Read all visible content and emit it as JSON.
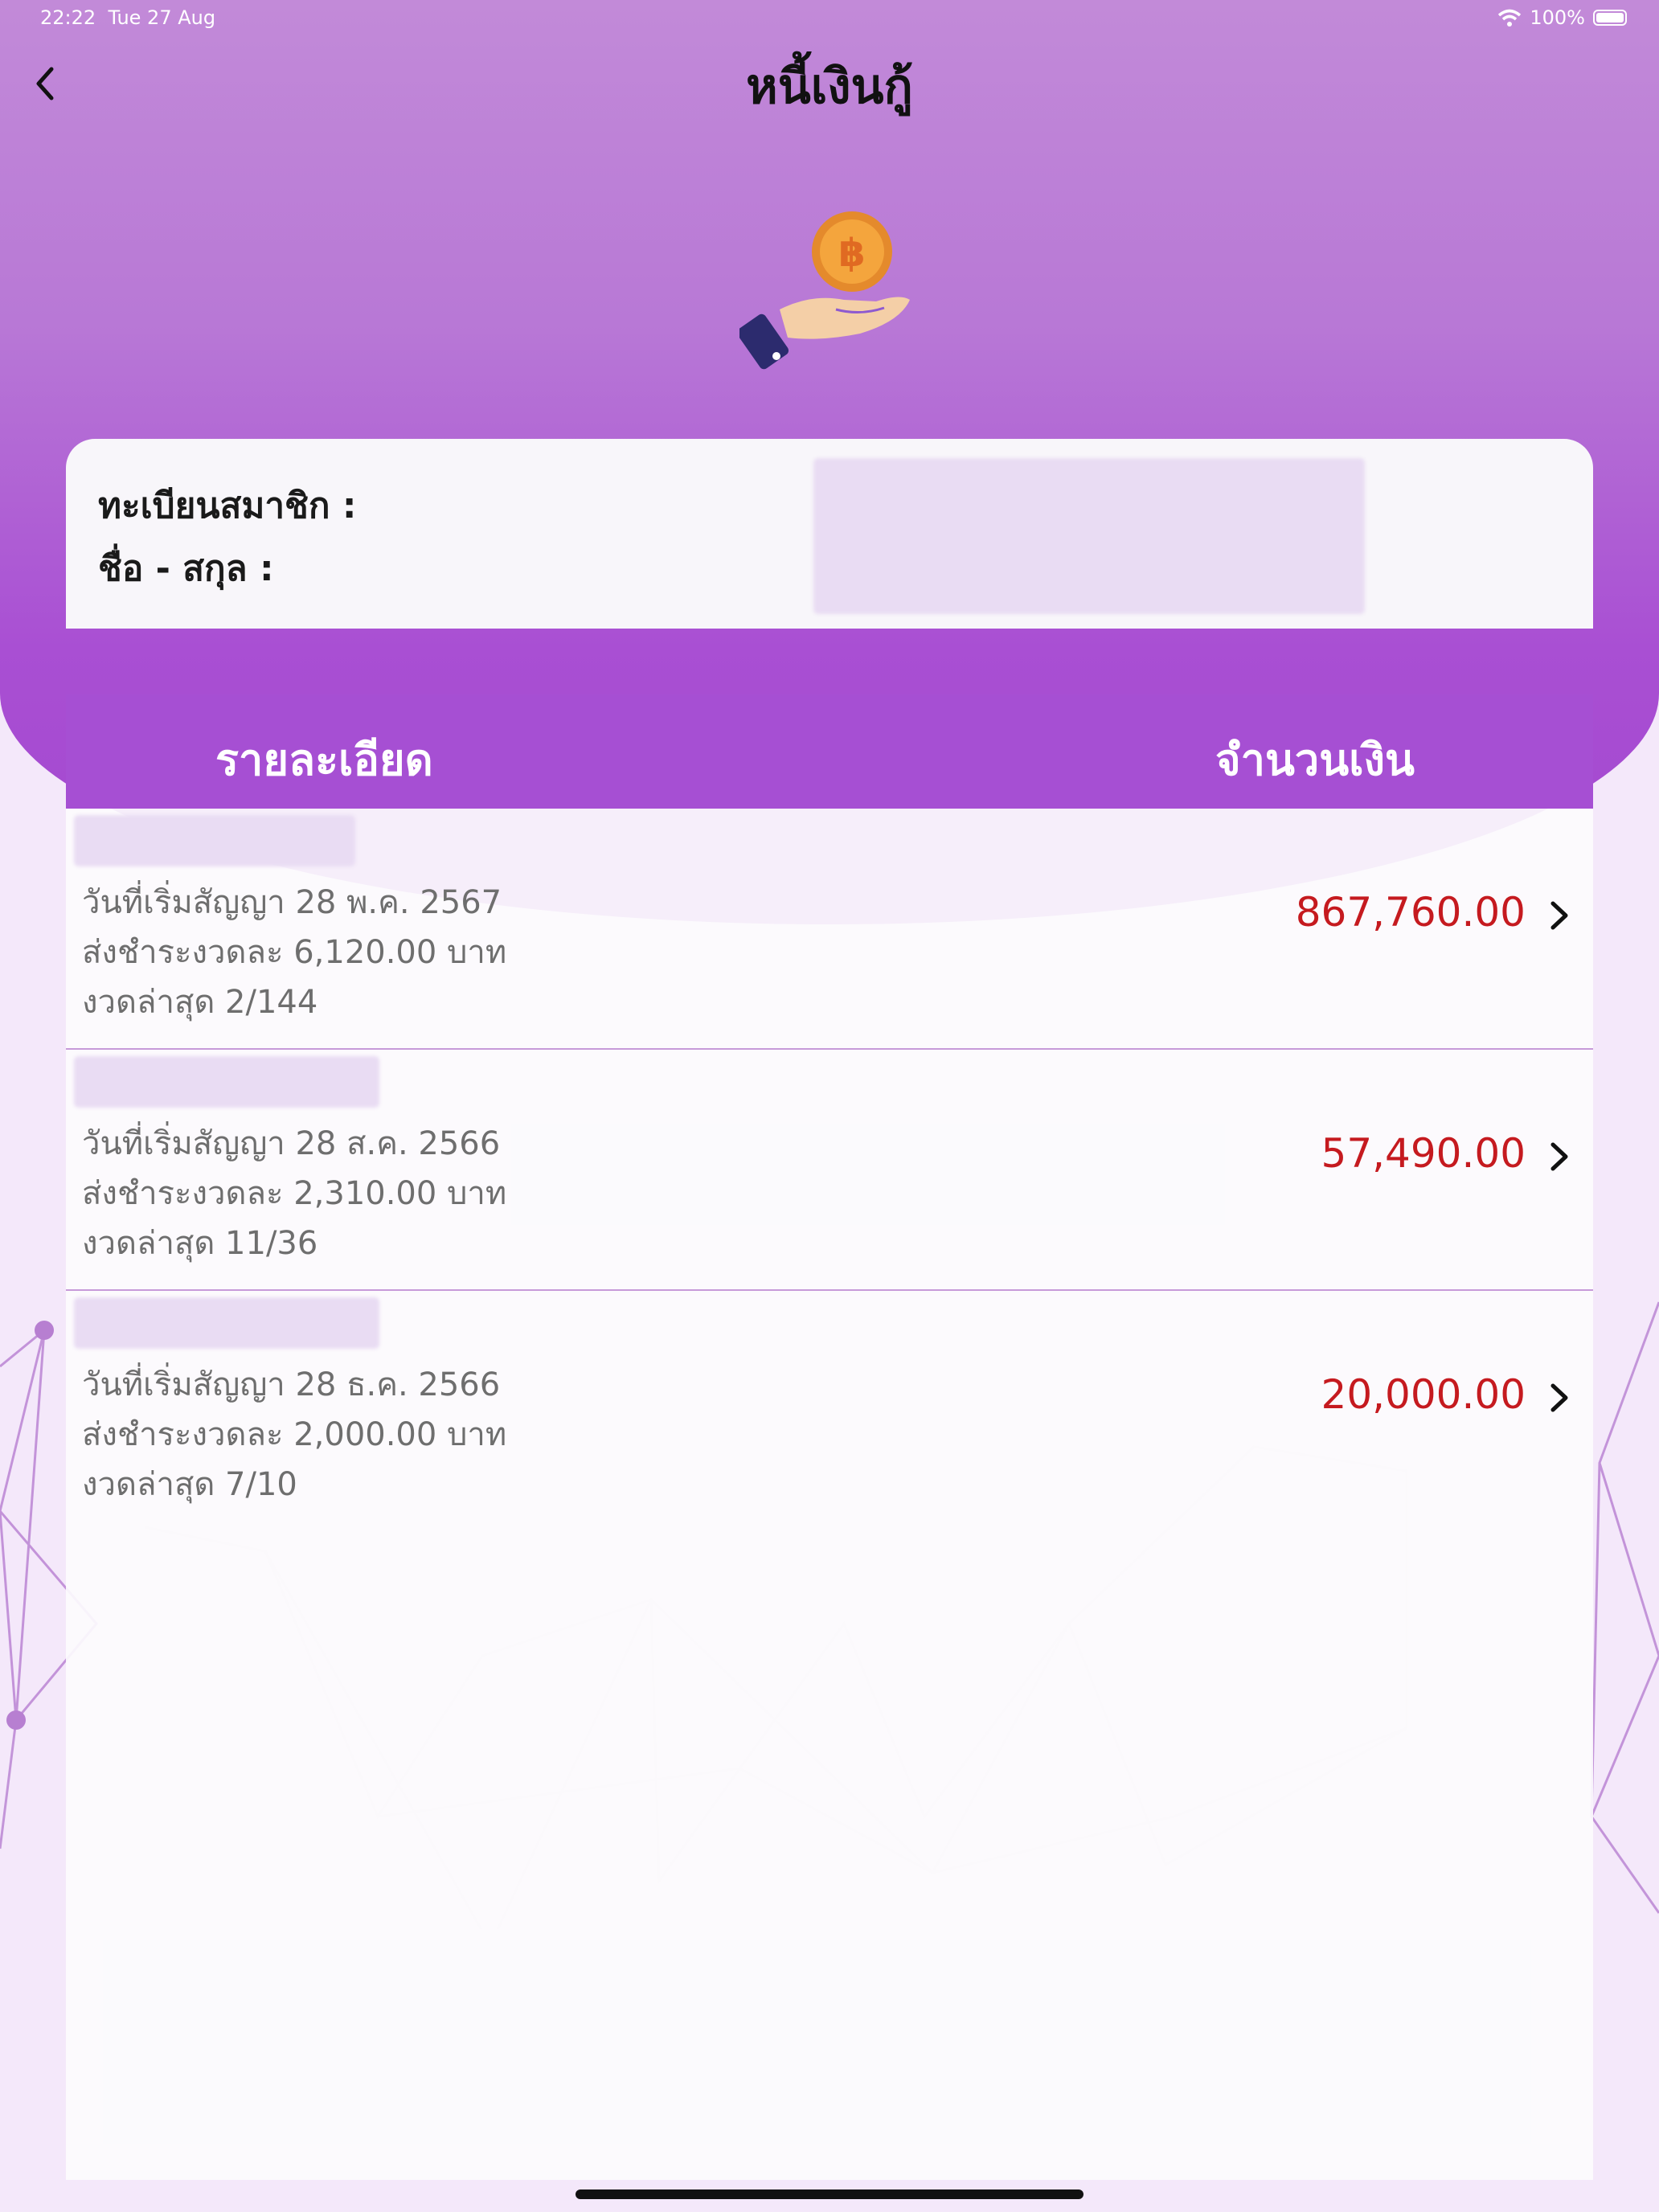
{
  "status_bar": {
    "time": "22:22",
    "date": "Tue 27 Aug",
    "battery": "100%"
  },
  "header": {
    "title": "หนี้เงินกู้"
  },
  "member": {
    "id_label": "ทะเบียนสมาชิก :",
    "name_label": "ชื่อ - สกุล :"
  },
  "table": {
    "col_detail": "รายละเอียด",
    "col_amount": "จำนวนเงิน"
  },
  "loans": [
    {
      "start": "วันที่เริ่มสัญญา 28 พ.ค. 2567",
      "installment": "ส่งชำระงวดละ 6,120.00 บาท",
      "latest": "งวดล่าสุด 2/144",
      "amount": "867,760.00"
    },
    {
      "start": "วันที่เริ่มสัญญา 28 ส.ค. 2566",
      "installment": "ส่งชำระงวดละ 2,310.00 บาท",
      "latest": "งวดล่าสุด 11/36",
      "amount": "57,490.00"
    },
    {
      "start": "วันที่เริ่มสัญญา 28 ธ.ค. 2566",
      "installment": "ส่งชำระงวดละ 2,000.00 บาท",
      "latest": "งวดล่าสุด 7/10",
      "amount": "20,000.00"
    }
  ],
  "icons": {
    "back": "chevron-left-icon",
    "hero": "hand-coin-icon",
    "row_arrow": "chevron-right-icon",
    "wifi": "wifi-icon",
    "battery": "battery-icon"
  },
  "colors": {
    "header_purple": "#a64fd3",
    "amount_red": "#c51a1f",
    "coin_orange": "#f0a23a"
  }
}
